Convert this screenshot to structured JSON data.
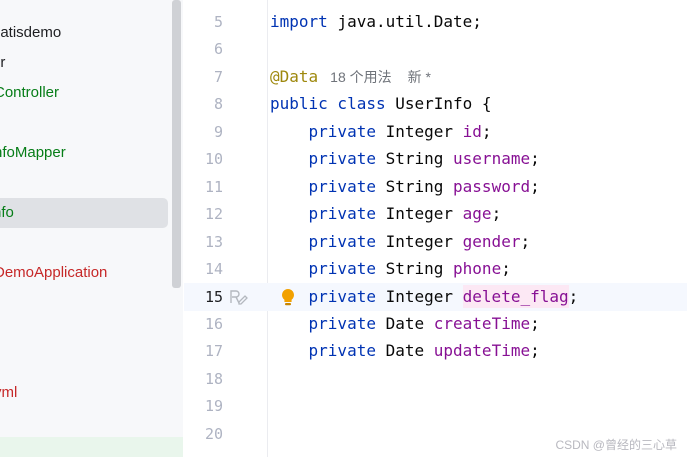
{
  "project_tree": {
    "items": [
      {
        "label": "patisdemo",
        "color": "#1e1f22",
        "selected": false
      },
      {
        "label": "er",
        "color": "#1e1f22",
        "selected": false
      },
      {
        "label": "Controller",
        "color": "#067d17",
        "selected": false
      },
      {
        "label": "nfoMapper",
        "color": "#067d17",
        "selected": false
      },
      {
        "label": "nfo",
        "color": "#067d17",
        "selected": true
      },
      {
        "label": "DemoApplication",
        "color": "#c62828",
        "selected": false
      },
      {
        "label": "yml",
        "color": "#c62828",
        "selected": false
      }
    ]
  },
  "editor": {
    "current_line": "15",
    "lines": [
      {
        "num": "5",
        "tokens": [
          {
            "t": "kw",
            "v": "import "
          },
          {
            "t": "type",
            "v": "java.util.Date;"
          }
        ]
      },
      {
        "num": "6",
        "tokens": []
      },
      {
        "num": "7",
        "tokens": [
          {
            "t": "anno",
            "v": "@Data"
          }
        ],
        "hints": [
          "18 个用法",
          "新 *"
        ]
      },
      {
        "num": "8",
        "tokens": [
          {
            "t": "kw",
            "v": "public class "
          },
          {
            "t": "type",
            "v": "UserInfo {"
          }
        ]
      },
      {
        "num": "9",
        "tokens": [
          {
            "t": "kw",
            "v": "    private "
          },
          {
            "t": "type",
            "v": "Integer "
          },
          {
            "t": "field",
            "v": "id"
          },
          {
            "t": "type",
            "v": ";"
          }
        ]
      },
      {
        "num": "10",
        "tokens": [
          {
            "t": "kw",
            "v": "    private "
          },
          {
            "t": "type",
            "v": "String "
          },
          {
            "t": "field",
            "v": "username"
          },
          {
            "t": "type",
            "v": ";"
          }
        ]
      },
      {
        "num": "11",
        "tokens": [
          {
            "t": "kw",
            "v": "    private "
          },
          {
            "t": "type",
            "v": "String "
          },
          {
            "t": "field",
            "v": "password"
          },
          {
            "t": "type",
            "v": ";"
          }
        ]
      },
      {
        "num": "12",
        "tokens": [
          {
            "t": "kw",
            "v": "    private "
          },
          {
            "t": "type",
            "v": "Integer "
          },
          {
            "t": "field",
            "v": "age"
          },
          {
            "t": "type",
            "v": ";"
          }
        ]
      },
      {
        "num": "13",
        "tokens": [
          {
            "t": "kw",
            "v": "    private "
          },
          {
            "t": "type",
            "v": "Integer "
          },
          {
            "t": "field",
            "v": "gender"
          },
          {
            "t": "type",
            "v": ";"
          }
        ]
      },
      {
        "num": "14",
        "tokens": [
          {
            "t": "kw",
            "v": "    private "
          },
          {
            "t": "type",
            "v": "String "
          },
          {
            "t": "field",
            "v": "phone"
          },
          {
            "t": "type",
            "v": ";"
          }
        ]
      },
      {
        "num": "15",
        "tokens": [
          {
            "t": "kw",
            "v": "    private "
          },
          {
            "t": "type",
            "v": "Integer "
          },
          {
            "t": "field-hl",
            "v": "delete_flag"
          },
          {
            "t": "type",
            "v": ";"
          }
        ],
        "icons": [
          "ai-rename-icon",
          "lightbulb-icon"
        ]
      },
      {
        "num": "16",
        "tokens": [
          {
            "t": "kw",
            "v": "    private "
          },
          {
            "t": "type",
            "v": "Date "
          },
          {
            "t": "field",
            "v": "createTime"
          },
          {
            "t": "type",
            "v": ";"
          }
        ]
      },
      {
        "num": "17",
        "tokens": [
          {
            "t": "kw",
            "v": "    private "
          },
          {
            "t": "type",
            "v": "Date "
          },
          {
            "t": "field",
            "v": "updateTime"
          },
          {
            "t": "type",
            "v": ";"
          }
        ]
      },
      {
        "num": "18",
        "tokens": []
      },
      {
        "num": "19",
        "tokens": []
      },
      {
        "num": "20",
        "tokens": []
      }
    ]
  },
  "watermark": "CSDN @曾经的三心草",
  "colors": {
    "keyword": "#0033b3",
    "field": "#871094",
    "annotation": "#9e880d",
    "line_number": "#aeb3c2",
    "current_line_bg": "#f5f8fe",
    "tree_bg": "#f7f8fa"
  }
}
